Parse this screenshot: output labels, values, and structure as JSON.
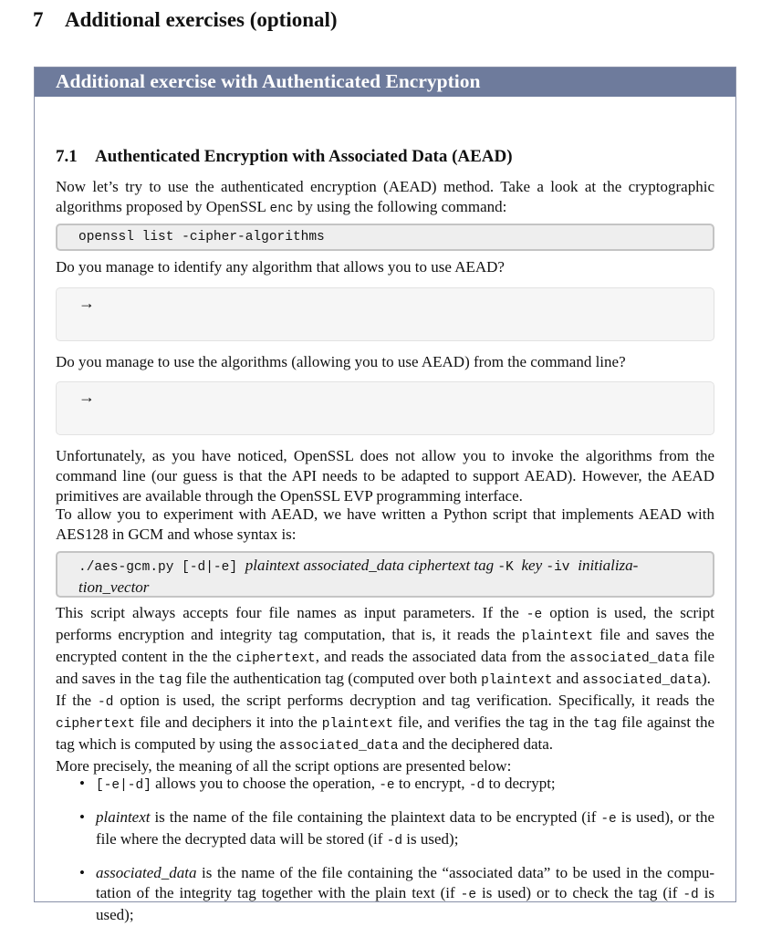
{
  "section": {
    "number": "7",
    "title": "Additional exercises (optional)"
  },
  "box": {
    "title": "Additional exercise with Authenticated Encryption",
    "subsection": {
      "number": "7.1",
      "title": "Authenticated Encryption with Associated Data (AEAD)"
    },
    "intro": {
      "part1": "Now let’s try to use the authenticated encryption (AEAD) method.  Take a look at the cryptographic algorithms proposed by OpenSSL ",
      "code": "enc",
      "part2": " by using the following command:"
    },
    "command1": "openssl list -cipher-algorithms",
    "question1": "Do you manage to identify any algorithm that allows you to use AEAD?",
    "question2": "Do you manage to use the algorithms (allowing you to use AEAD) from the command line?",
    "answer_arrow": "→",
    "para_unfortunately": "Unfortunately, as you have noticed, OpenSSL does not allow you to invoke the algorithms from the command line (our guess is that the API needs to be adapted to support AEAD). However, the AEAD primitives are available through the OpenSSL EVP programming interface.",
    "para_allow": "To allow you to experiment with AEAD, we have written a Python script that implements AEAD with AES128 in GCM and whose syntax is:",
    "syntax": {
      "cmd": "./aes-gcm.py [-d|-e] ",
      "args": "plaintext associated_data ciphertext tag ",
      "k_opt": "-K ",
      "key": "key ",
      "iv_opt": "-iv ",
      "iv_line1": "initializa-",
      "iv_line2": "tion_vector"
    },
    "desc": {
      "s1": "This script always accepts four file names as input parameters.  If the ",
      "c1": "-e",
      "s2": " option is used, the script performs encryption and integrity tag computation, that is, it reads the ",
      "c2": "plaintext",
      "s3": " file and saves the encrypted content in the the ",
      "c3": "ciphertext",
      "s4": ", and reads the associated data from the ",
      "c4": "associated_data",
      "s5": " file and saves in the ",
      "c5": "tag",
      "s6": " file the authentication tag (computed over both ",
      "c6": "plaintext",
      "s7": " and ",
      "c7": "associated_data",
      "s8": ").",
      "s9": "If the ",
      "c9": "-d",
      "s10": " option is used, the script performs decryption and tag verification.  Specifically, it reads the ",
      "c10": "ciphertext",
      "s11": " file and deciphers it into the ",
      "c11": "plaintext",
      "s12": " file, and verifies the tag in the ",
      "c12": "tag",
      "s13": " file against the tag which is computed by using the ",
      "c13": "associated_data",
      "s14": " and the deciphered data.",
      "s15": "More precisely, the meaning of all the script options are presented below:"
    },
    "options": [
      {
        "code": "[-e|-d]",
        "text1": " allows you to choose the operation, ",
        "c1": "-e",
        "text2": " to encrypt, ",
        "c2": "-d",
        "text3": " to decrypt;"
      },
      {
        "term": "plaintext",
        "text1": " is the name of the file containing the plaintext data to be encrypted (if ",
        "c1": "-e",
        "text2": " is used), or the file where the decrypted data will be stored (if ",
        "c2": "-d",
        "text3": " is used);"
      },
      {
        "term": "associated_data",
        "text1": " is the name of the file containing the “associated data” to be used in the compu-tation of the integrity tag together with the plain text (if ",
        "c1": "-e",
        "text2": " is used) or to check the tag (if ",
        "c2": "-d",
        "text3": " is used);"
      }
    ]
  }
}
